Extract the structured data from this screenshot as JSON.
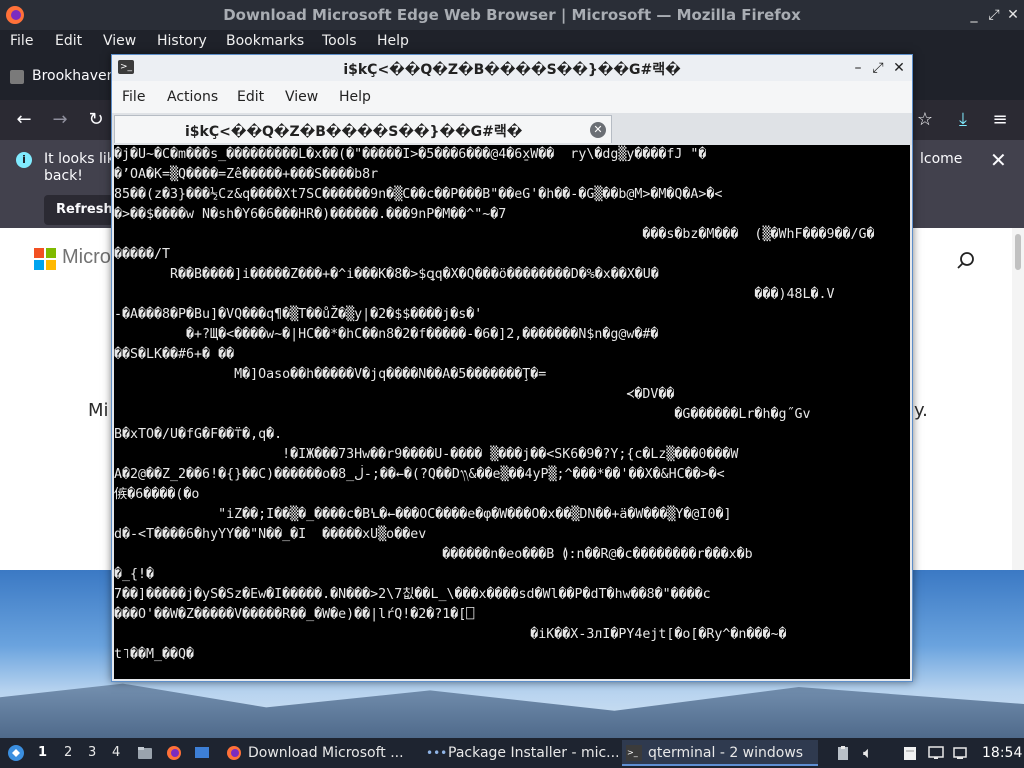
{
  "firefox": {
    "window_title": "Download Microsoft Edge Web Browser | Microsoft — Mozilla Firefox",
    "menu": [
      "File",
      "Edit",
      "View",
      "History",
      "Bookmarks",
      "Tools",
      "Help"
    ],
    "tab_label": "Brookhaven",
    "notice": {
      "text_line1": "It looks lik",
      "text_line2": "back!",
      "text_right": "lcome",
      "refresh_label": "Refresh"
    },
    "content": {
      "brand": "Micro",
      "fragment_left": "Mi",
      "fragment_right": "y."
    }
  },
  "qterminal": {
    "title": "i$kÇ<��Q�Z�B����S��}��G#랙�",
    "menu": [
      "File",
      "Actions",
      "Edit",
      "View",
      "Help"
    ],
    "tab_label": "i$kÇ<��Q�Z�B����S��}��G#랙�",
    "lines": [
      "�j�U~�C�m���s_���������L�x��(�\"�����I>�5���6���@4�6x̱W��  ry\\�dg▒y����fJ \"�",
      "�’OA�K=▒Q����=Zê�����+���S����b8r",
      "85��(z�3}���½Cz&q����Xt7SC������9n�▒C��c��P���B\"��eG'�h��-�G▒��b@M>�M�Q�A>�<",
      "�>��$����w N�sh�Y6�6���HR�)������.���9nP�M��^\"~�7",
      "                                                                  ���s�bz�M���  (▒�WhF���9��/G�",
      "�����/T",
      "       R��B����]i�����Z���+�^i���K�8�>$ꝗq�X�Q���ö��������D�%�x��X�U�",
      "                                                                                ���)48L�.V",
      "-�A���8�P�Bu]�VQ���q¶�▒T��ůŽ�▒y|�2�$$����j�s�'",
      "         �+?Щ�<����w~�|HC��*�hC��n8�2�f�����-�6�]2,�������N$n�g@w�#�",
      "��S�LK��#6+� ��",
      "               M�]Oaso��h�����V�jq����N��A�5�������Ţ�=",
      "                                                                ≺�DV��",
      "                                                                      �G������Lr�h�g˝Gv",
      "B�xTO�/U�fG�F��⍡�,q�.",
      "                     !�IЖ���73Hw��r9����U-���� ▒���j��<SK6�9�?Y;{c�Lz▒���0���W",
      "A�2@��Z_2��6!�{}��C)������o�8_ڶ-;��←�(?Q��D᭟&��e▒��4yP▒;^���*��'��X�&HC��>�<",
      "㑵�6����(�o",
      "             \"iZ��;I��▒�_����c�BꝆ�←���OC����e�φ�W���O�x��▒DN��+ä�W���▒Y�@I0�]",
      "d�-<T����6�hyYY��\"N��_�I  �����xU▒o��ev",
      "                                         ������n�eo���B ≬:n��R@�c��������r���x�b",
      "�_{!�",
      "7��]�����j�yS�Sz�Ew�I�����.�N���>2\\7칪��L_\\���x����sd�Wl��P�dT�hw��8�\"����c",
      "���O'��W�Z�����V�����R��_�W�e)��|lŕQ!�2�?1�[⎕",
      "                                                    �iK��X-3лI�PY4ejt[�o[�Ry^�n���~�",
      "t˥��M_��Q�"
    ]
  },
  "taskbar": {
    "desktops": [
      "1",
      "2",
      "3",
      "4"
    ],
    "tasks": [
      {
        "label": "Download Microsoft ..."
      },
      {
        "label": "Package Installer - mic..."
      },
      {
        "label": "qterminal - 2 windows"
      }
    ],
    "clock": "18:54"
  },
  "colors": {
    "accent": "#5f8fd3",
    "terminal_bg": "#000000",
    "terminal_fg": "#e8e8e8",
    "firefox_dark": "#1f222a"
  }
}
